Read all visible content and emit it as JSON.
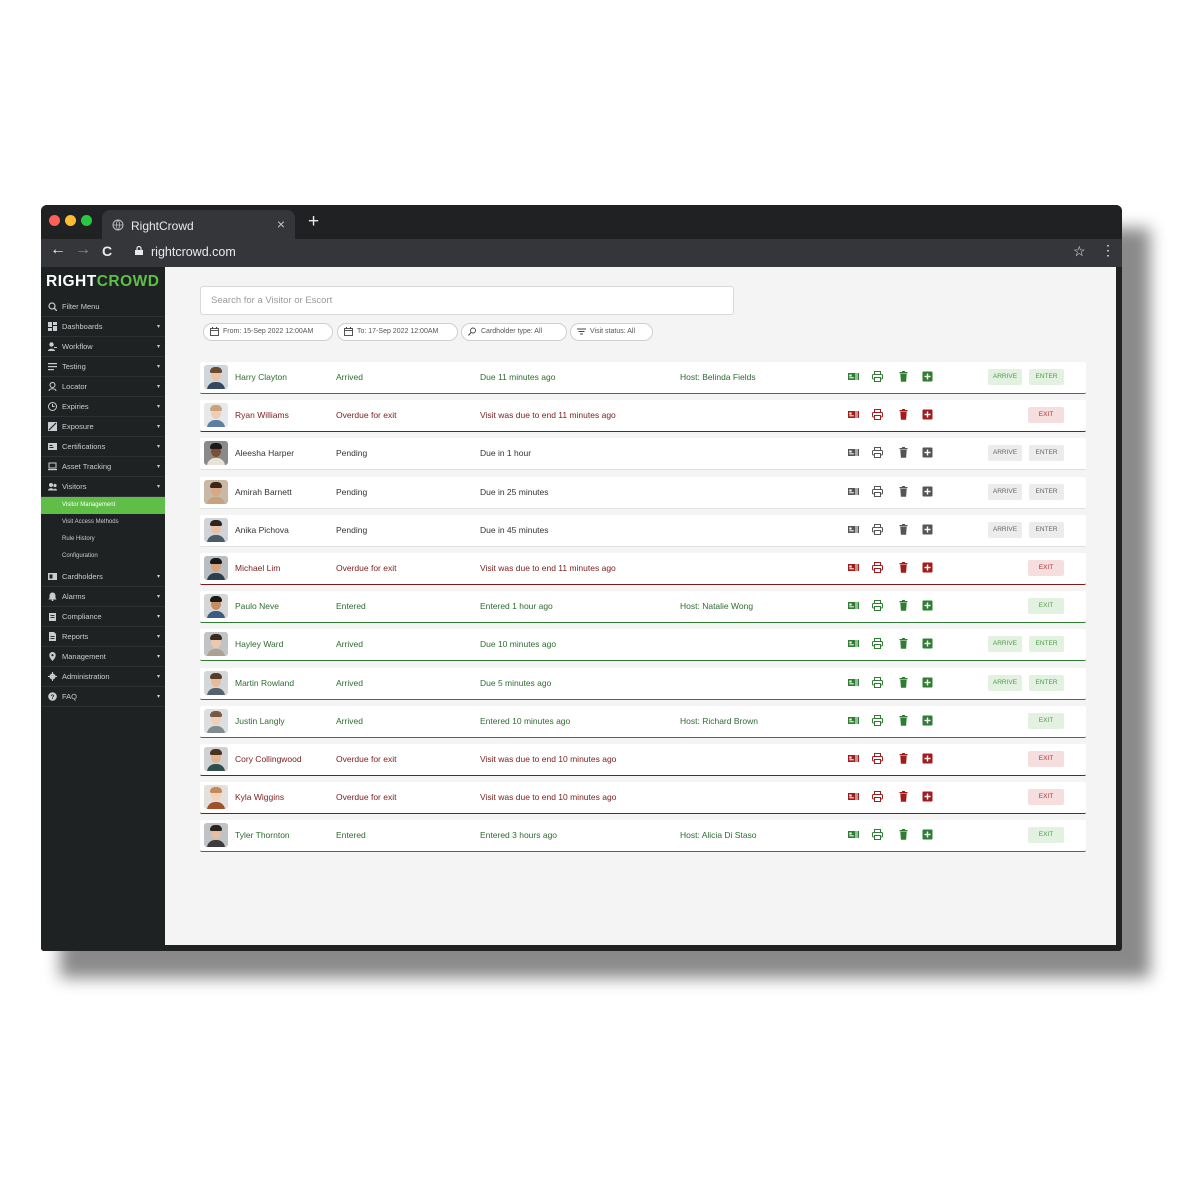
{
  "browser": {
    "tab_title": "RightCrowd",
    "tab_close": "×",
    "new_tab": "+",
    "url": "rightcrowd.com",
    "back": "←",
    "forward": "→",
    "reload": "C",
    "star": "☆",
    "menu": "⋮"
  },
  "sidebar": {
    "logo_right": "RIGHT",
    "logo_crowd": "CROWD",
    "filter_menu": "Filter Menu",
    "items": [
      {
        "label": "Dashboards",
        "icon": "dashboard-icon"
      },
      {
        "label": "Workflow",
        "icon": "workflow-icon"
      },
      {
        "label": "Testing",
        "icon": "testing-icon"
      },
      {
        "label": "Locator",
        "icon": "locator-icon"
      },
      {
        "label": "Expiries",
        "icon": "clock-icon"
      },
      {
        "label": "Exposure",
        "icon": "exposure-icon"
      },
      {
        "label": "Certifications",
        "icon": "certificate-icon"
      },
      {
        "label": "Asset Tracking",
        "icon": "laptop-icon"
      },
      {
        "label": "Visitors",
        "icon": "visitors-icon"
      }
    ],
    "sub_items": [
      "Visitor Management",
      "Visit Access Methods",
      "Rule History",
      "Configuration"
    ],
    "items_after": [
      {
        "label": "Cardholders",
        "icon": "id-card-icon"
      },
      {
        "label": "Alarms",
        "icon": "bell-icon"
      },
      {
        "label": "Compliance",
        "icon": "clipboard-icon"
      },
      {
        "label": "Reports",
        "icon": "report-icon"
      },
      {
        "label": "Management",
        "icon": "pin-icon"
      },
      {
        "label": "Administration",
        "icon": "gear-icon"
      },
      {
        "label": "FAQ",
        "icon": "help-icon"
      }
    ],
    "caret": "▾"
  },
  "search": {
    "placeholder": "Search for a Visitor or Escort"
  },
  "filters": {
    "from": "From: 15-Sep 2022 12:00AM",
    "to": "To: 17-Sep 2022 12:00AM",
    "cardholder_type": "Cardholder type: All",
    "visit_status": "Visit status: All"
  },
  "buttons": {
    "arrive": "ARRIVE",
    "enter": "ENTER",
    "exit": "EXIT"
  },
  "colors": {
    "brand_green": "#5fbe46",
    "status_green": "#2e6b30",
    "status_red": "#7b1c1c",
    "action_green": "#2e7d32",
    "action_red": "#a31c1c",
    "action_grey": "#555555"
  },
  "visits": [
    {
      "name": "Harry Clayton",
      "status": "Arrived",
      "due": "Due 11 minutes ago",
      "host": "Host: Belinda Fields",
      "state": "good",
      "buttons": "arrive-enter"
    },
    {
      "name": "Ryan Williams",
      "status": "Overdue for exit",
      "due": "Visit was due to end 11 minutes ago",
      "host": "",
      "state": "bad",
      "buttons": "exit"
    },
    {
      "name": "Aleesha Harper",
      "status": "Pending",
      "due": "Due in 1 hour",
      "host": "",
      "state": "pend",
      "buttons": "arrive-enter"
    },
    {
      "name": "Amirah Barnett",
      "status": "Pending",
      "due": "Due in 25 minutes",
      "host": "",
      "state": "pend",
      "buttons": "arrive-enter"
    },
    {
      "name": "Anika Pichova",
      "status": "Pending",
      "due": "Due in 45 minutes",
      "host": "",
      "state": "pend",
      "buttons": "arrive-enter"
    },
    {
      "name": "Michael Lim",
      "status": "Overdue for exit",
      "due": "Visit was due to end 11 minutes ago",
      "host": "",
      "state": "bad",
      "buttons": "exit"
    },
    {
      "name": "Paulo Neve",
      "status": "Entered",
      "due": "Entered 1 hour ago",
      "host": "Host: Natalie Wong",
      "state": "good",
      "buttons": "exit"
    },
    {
      "name": "Hayley Ward",
      "status": "Arrived",
      "due": "Due 10 minutes ago",
      "host": "",
      "state": "good",
      "buttons": "arrive-enter"
    },
    {
      "name": "Martin Rowland",
      "status": "Arrived",
      "due": "Due 5 minutes ago",
      "host": "",
      "state": "good",
      "buttons": "arrive-enter"
    },
    {
      "name": "Justin Langly",
      "status": "Arrived",
      "due": "Entered 10 minutes ago",
      "host": "Host: Richard Brown",
      "state": "good",
      "buttons": "exit"
    },
    {
      "name": "Cory Collingwood",
      "status": "Overdue for exit",
      "due": "Visit was due to end 10 minutes ago",
      "host": "",
      "state": "bad",
      "buttons": "exit"
    },
    {
      "name": "Kyla Wiggins",
      "status": "Overdue for exit",
      "due": "Visit was due to end 10 minutes ago",
      "host": "",
      "state": "bad",
      "buttons": "exit"
    },
    {
      "name": "Tyler Thornton",
      "status": "Entered",
      "due": "Entered 3 hours ago",
      "host": "Host: Alicia Di Staso",
      "state": "good",
      "buttons": "exit"
    }
  ]
}
